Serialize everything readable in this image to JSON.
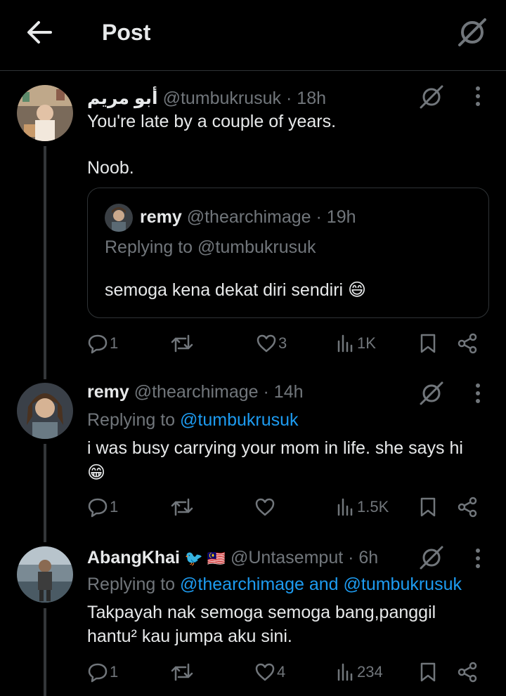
{
  "header": {
    "title": "Post"
  },
  "tweets": [
    {
      "name": "أبو مريم",
      "handle": "@tumbukrusuk",
      "time": "· 18h",
      "lines": [
        "You're late by a couple of years.",
        "Noob."
      ],
      "quote": {
        "name": "remy",
        "handle": "@thearchimage",
        "time": "· 19h",
        "replying": "Replying to @tumbukrusuk",
        "text": "semoga kena dekat diri sendiri 😄"
      },
      "stats": {
        "replies": "1",
        "retweets": "",
        "likes": "3",
        "views": "1K"
      }
    },
    {
      "name": "remy",
      "handle": "@thearchimage",
      "time": "· 14h",
      "replying_prefix": "Replying to",
      "replying_users": "@tumbukrusuk",
      "lines": [
        "i was busy carrying your mom in life. she says hi",
        "😁"
      ],
      "stats": {
        "replies": "1",
        "retweets": "",
        "likes": "",
        "views": "1.5K"
      }
    },
    {
      "name": "AbangKhai",
      "badges": "🐦 🇲🇾",
      "handle": "@Untasemput",
      "time": "· 6h",
      "replying_prefix": "Replying to",
      "replying_users": "@thearchimage and @tumbukrusuk",
      "lines": [
        "Takpayah nak semoga semoga bang,panggil",
        "hantu² kau jumpa aku sini."
      ],
      "stats": {
        "replies": "1",
        "retweets": "",
        "likes": "4",
        "views": "234"
      }
    }
  ],
  "colors": {
    "background": "#000000",
    "text": "#e7e9ea",
    "muted": "#71767b",
    "link": "#1d9bf0",
    "border": "#2f3336"
  }
}
